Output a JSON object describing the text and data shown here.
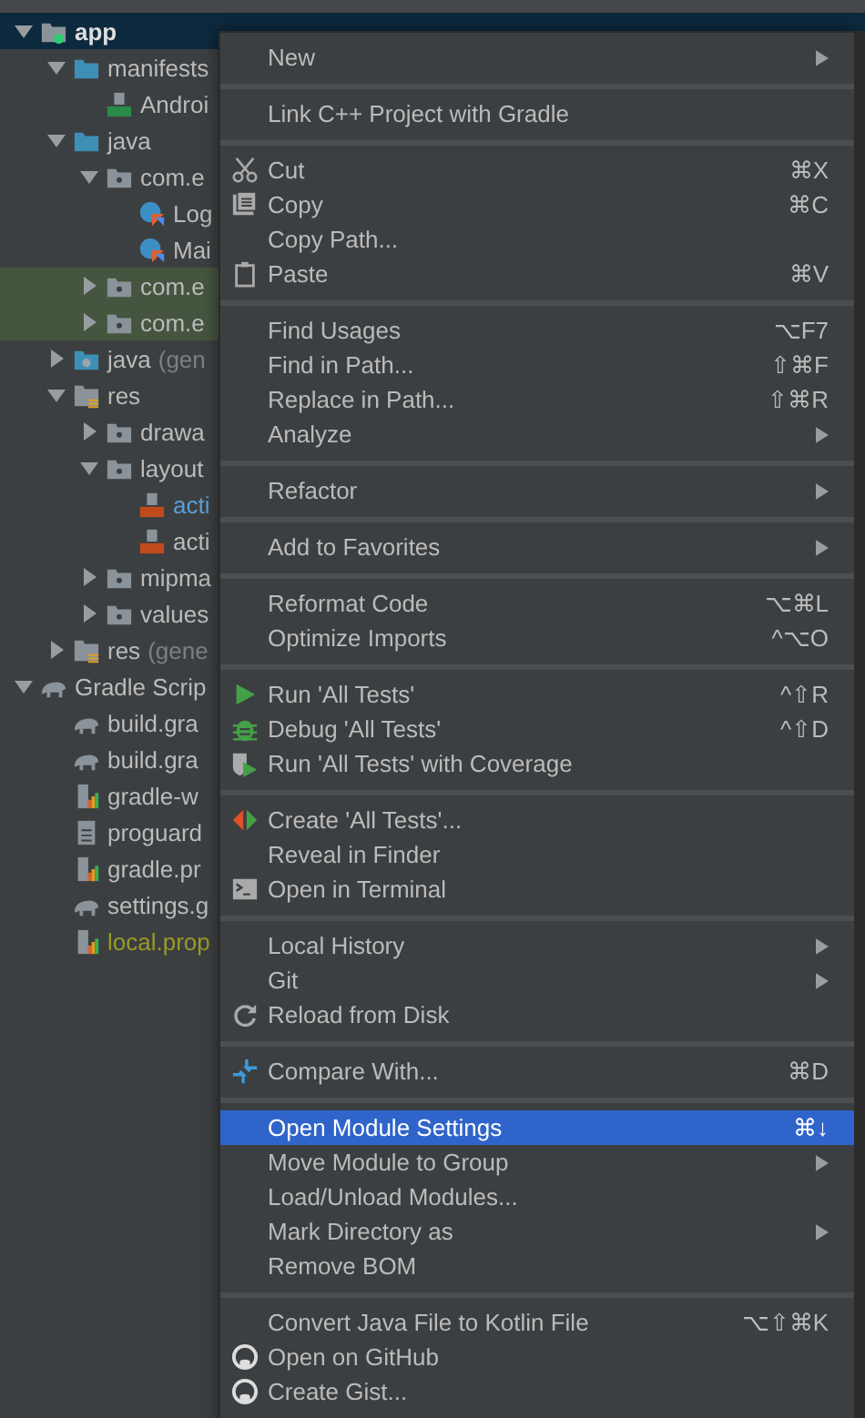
{
  "tree": [
    {
      "label": "app",
      "kind": "module",
      "expanded": true,
      "highlighted": false,
      "selected": true,
      "color": "#dddddd",
      "children": [
        {
          "label": "manifests",
          "kind": "folder",
          "expanded": true,
          "highlighted": false,
          "selected": false,
          "color": "#bbbbbb",
          "children": [
            {
              "label": "Androi",
              "kind": "manifest",
              "highlighted": false,
              "selected": false,
              "color": "#bbbbbb"
            }
          ]
        },
        {
          "label": "java",
          "kind": "folder",
          "expanded": true,
          "highlighted": false,
          "selected": false,
          "color": "#bbbbbb",
          "children": [
            {
              "label": "com.e",
              "kind": "package",
              "expanded": true,
              "highlighted": false,
              "selected": false,
              "color": "#bbbbbb",
              "children": [
                {
                  "label": "Log",
                  "kind": "kotlin",
                  "highlighted": false,
                  "selected": false,
                  "color": "#bbbbbb"
                },
                {
                  "label": "Mai",
                  "kind": "kotlin",
                  "highlighted": false,
                  "selected": false,
                  "color": "#bbbbbb"
                }
              ]
            },
            {
              "label": "com.e",
              "kind": "package",
              "expanded": false,
              "highlighted": true,
              "selected": false,
              "color": "#bbbbbb"
            },
            {
              "label": "com.e",
              "kind": "package",
              "expanded": false,
              "highlighted": true,
              "selected": false,
              "color": "#bbbbbb"
            }
          ]
        },
        {
          "label": "java",
          "suffix": "(gen",
          "kind": "genfolder",
          "expanded": false,
          "highlighted": false,
          "selected": false,
          "color": "#bbbbbb"
        },
        {
          "label": "res",
          "kind": "resfolder",
          "expanded": true,
          "highlighted": false,
          "selected": false,
          "color": "#bbbbbb",
          "children": [
            {
              "label": "drawa",
              "kind": "package",
              "expanded": false,
              "highlighted": false,
              "selected": false,
              "color": "#bbbbbb"
            },
            {
              "label": "layout",
              "kind": "package",
              "expanded": true,
              "highlighted": false,
              "selected": false,
              "color": "#bbbbbb",
              "children": [
                {
                  "label": "acti",
                  "kind": "layout",
                  "highlighted": false,
                  "selected": false,
                  "color": "#5c9fd8"
                },
                {
                  "label": "acti",
                  "kind": "layout",
                  "highlighted": false,
                  "selected": false,
                  "color": "#bbbbbb"
                }
              ]
            },
            {
              "label": "mipma",
              "kind": "package",
              "expanded": false,
              "highlighted": false,
              "selected": false,
              "color": "#bbbbbb"
            },
            {
              "label": "values",
              "kind": "package",
              "expanded": false,
              "highlighted": false,
              "selected": false,
              "color": "#bbbbbb"
            }
          ]
        },
        {
          "label": "res",
          "suffix": "(gene",
          "kind": "resfolder",
          "expanded": false,
          "highlighted": false,
          "selected": false,
          "color": "#bbbbbb"
        }
      ]
    },
    {
      "label": "Gradle Scrip",
      "kind": "gradleroot",
      "expanded": true,
      "highlighted": false,
      "selected": false,
      "color": "#bbbbbb",
      "children": [
        {
          "label": "build.gra",
          "kind": "gradle",
          "highlighted": false,
          "selected": false,
          "color": "#bbbbbb"
        },
        {
          "label": "build.gra",
          "kind": "gradle",
          "highlighted": false,
          "selected": false,
          "color": "#bbbbbb"
        },
        {
          "label": "gradle-w",
          "kind": "properties",
          "highlighted": false,
          "selected": false,
          "color": "#bbbbbb"
        },
        {
          "label": "proguard",
          "kind": "text",
          "highlighted": false,
          "selected": false,
          "color": "#bbbbbb"
        },
        {
          "label": "gradle.pr",
          "kind": "properties",
          "highlighted": false,
          "selected": false,
          "color": "#bbbbbb"
        },
        {
          "label": "settings.g",
          "kind": "gradle",
          "highlighted": false,
          "selected": false,
          "color": "#bbbbbb"
        },
        {
          "label": "local.prop",
          "kind": "properties",
          "highlighted": false,
          "selected": false,
          "color": "#9a9a28"
        }
      ]
    }
  ],
  "context_menu": {
    "groups": [
      [
        {
          "label": "New",
          "kind": "plain",
          "submenu": true,
          "selected": false
        }
      ],
      [
        {
          "label": "Link C++ Project with Gradle",
          "kind": "plain",
          "submenu": false,
          "selected": false
        }
      ],
      [
        {
          "label": "Cut",
          "shortcut": "⌘X",
          "kind": "scissors",
          "submenu": false,
          "selected": false
        },
        {
          "label": "Copy",
          "shortcut": "⌘C",
          "kind": "copy",
          "submenu": false,
          "selected": false
        },
        {
          "label": "Copy Path...",
          "kind": "plain",
          "submenu": false,
          "selected": false
        },
        {
          "label": "Paste",
          "shortcut": "⌘V",
          "kind": "clipboard",
          "submenu": false,
          "selected": false
        }
      ],
      [
        {
          "label": "Find Usages",
          "shortcut": "⌥F7",
          "kind": "plain",
          "submenu": false,
          "selected": false
        },
        {
          "label": "Find in Path...",
          "shortcut": "⇧⌘F",
          "kind": "plain",
          "submenu": false,
          "selected": false
        },
        {
          "label": "Replace in Path...",
          "shortcut": "⇧⌘R",
          "kind": "plain",
          "submenu": false,
          "selected": false
        },
        {
          "label": "Analyze",
          "kind": "plain",
          "submenu": true,
          "selected": false
        }
      ],
      [
        {
          "label": "Refactor",
          "kind": "plain",
          "submenu": true,
          "selected": false
        }
      ],
      [
        {
          "label": "Add to Favorites",
          "kind": "plain",
          "submenu": true,
          "selected": false
        }
      ],
      [
        {
          "label": "Reformat Code",
          "shortcut": "⌥⌘L",
          "kind": "plain",
          "submenu": false,
          "selected": false
        },
        {
          "label": "Optimize Imports",
          "shortcut": "^⌥O",
          "kind": "plain",
          "submenu": false,
          "selected": false
        }
      ],
      [
        {
          "label": "Run 'All Tests'",
          "shortcut": "^⇧R",
          "kind": "run",
          "submenu": false,
          "selected": false
        },
        {
          "label": "Debug 'All Tests'",
          "shortcut": "^⇧D",
          "kind": "debug",
          "submenu": false,
          "selected": false
        },
        {
          "label": "Run 'All Tests' with Coverage",
          "kind": "coverage",
          "submenu": false,
          "selected": false
        }
      ],
      [
        {
          "label": "Create 'All Tests'...",
          "kind": "createtest",
          "submenu": false,
          "selected": false
        },
        {
          "label": "Reveal in Finder",
          "kind": "plain",
          "submenu": false,
          "selected": false
        },
        {
          "label": "Open in Terminal",
          "kind": "terminal",
          "submenu": false,
          "selected": false
        }
      ],
      [
        {
          "label": "Local History",
          "kind": "plain",
          "submenu": true,
          "selected": false
        },
        {
          "label": "Git",
          "kind": "plain",
          "submenu": true,
          "selected": false
        },
        {
          "label": "Reload from Disk",
          "kind": "reload",
          "submenu": false,
          "selected": false
        }
      ],
      [
        {
          "label": "Compare With...",
          "shortcut": "⌘D",
          "kind": "compare",
          "submenu": false,
          "selected": false
        }
      ],
      [
        {
          "label": "Open Module Settings",
          "shortcut": "⌘↓",
          "kind": "plain",
          "submenu": false,
          "selected": true
        },
        {
          "label": "Move Module to Group",
          "kind": "plain",
          "submenu": true,
          "selected": false
        },
        {
          "label": "Load/Unload Modules...",
          "kind": "plain",
          "submenu": false,
          "selected": false
        },
        {
          "label": "Mark Directory as",
          "kind": "plain",
          "submenu": true,
          "selected": false
        },
        {
          "label": "Remove BOM",
          "kind": "plain",
          "submenu": false,
          "selected": false
        }
      ],
      [
        {
          "label": "Convert Java File to Kotlin File",
          "shortcut": "⌥⇧⌘K",
          "kind": "plain",
          "submenu": false,
          "selected": false
        },
        {
          "label": "Open on GitHub",
          "kind": "github",
          "submenu": false,
          "selected": false
        },
        {
          "label": "Create Gist...",
          "kind": "github",
          "submenu": false,
          "selected": false
        }
      ]
    ]
  }
}
